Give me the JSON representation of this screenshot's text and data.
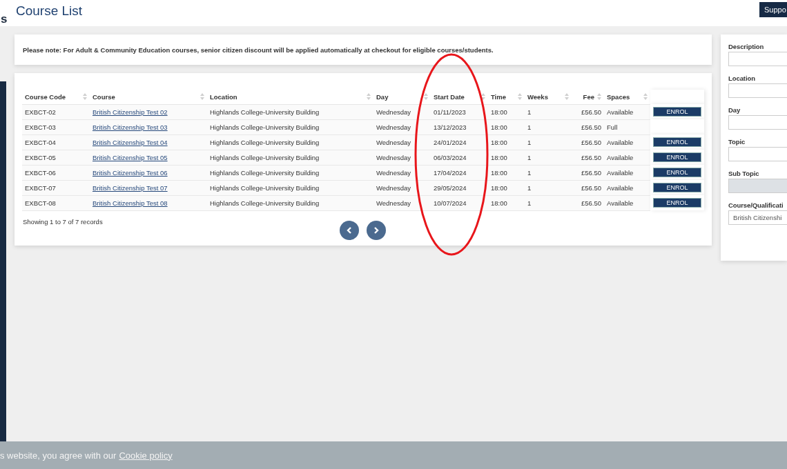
{
  "sidebar_fragment": "s",
  "header": {
    "title": "Course List",
    "support_button": "Suppo"
  },
  "notice": {
    "text": "Please note: For Adult & Community Education courses, senior citizen discount will be applied automatically at checkout for eligible courses/students."
  },
  "table": {
    "columns": [
      "Course Code",
      "Course",
      "Location",
      "Day",
      "Start Date",
      "Time",
      "Weeks",
      "Fee",
      "Spaces"
    ],
    "rows": [
      {
        "code": "EXBCT-02",
        "course": "British Citizenship Test 02",
        "location": "Highlands College-University Building",
        "day": "Wednesday",
        "start_date": "01/11/2023",
        "time": "18:00",
        "weeks": "1",
        "fee": "£56.50",
        "spaces": "Available",
        "action": "ENROL"
      },
      {
        "code": "EXBCT-03",
        "course": "British Citizenship Test 03",
        "location": "Highlands College-University Building",
        "day": "Wednesday",
        "start_date": "13/12/2023",
        "time": "18:00",
        "weeks": "1",
        "fee": "£56.50",
        "spaces": "Full"
      },
      {
        "code": "EXBCT-04",
        "course": "British Citizenship Test 04",
        "location": "Highlands College-University Building",
        "day": "Wednesday",
        "start_date": "24/01/2024",
        "time": "18:00",
        "weeks": "1",
        "fee": "£56.50",
        "spaces": "Available",
        "action": "ENROL"
      },
      {
        "code": "EXBCT-05",
        "course": "British Citizenship Test 05",
        "location": "Highlands College-University Building",
        "day": "Wednesday",
        "start_date": "06/03/2024",
        "time": "18:00",
        "weeks": "1",
        "fee": "£56.50",
        "spaces": "Available",
        "action": "ENROL"
      },
      {
        "code": "EXBCT-06",
        "course": "British Citizenship Test 06",
        "location": "Highlands College-University Building",
        "day": "Wednesday",
        "start_date": "17/04/2024",
        "time": "18:00",
        "weeks": "1",
        "fee": "£56.50",
        "spaces": "Available",
        "action": "ENROL"
      },
      {
        "code": "EXBCT-07",
        "course": "British Citizenship Test 07",
        "location": "Highlands College-University Building",
        "day": "Wednesday",
        "start_date": "29/05/2024",
        "time": "18:00",
        "weeks": "1",
        "fee": "£56.50",
        "spaces": "Available",
        "action": "ENROL"
      },
      {
        "code": "EXBCT-08",
        "course": "British Citizenship Test 08",
        "location": "Highlands College-University Building",
        "day": "Wednesday",
        "start_date": "10/07/2024",
        "time": "18:00",
        "weeks": "1",
        "fee": "£56.50",
        "spaces": "Available",
        "action": "ENROL"
      }
    ],
    "summary": "Showing 1 to 7 of 7 records"
  },
  "filters": [
    {
      "label": "Description",
      "disabled": false
    },
    {
      "label": "Location",
      "disabled": false
    },
    {
      "label": "Day",
      "disabled": false
    },
    {
      "label": "Topic",
      "disabled": false
    },
    {
      "label": "Sub Topic",
      "disabled": true
    },
    {
      "label": "Course/Qualificati",
      "disabled": false,
      "value": "British Citizenshi"
    }
  ],
  "cookie_bar": {
    "text": "s website, you agree with our",
    "link": "Cookie policy"
  }
}
